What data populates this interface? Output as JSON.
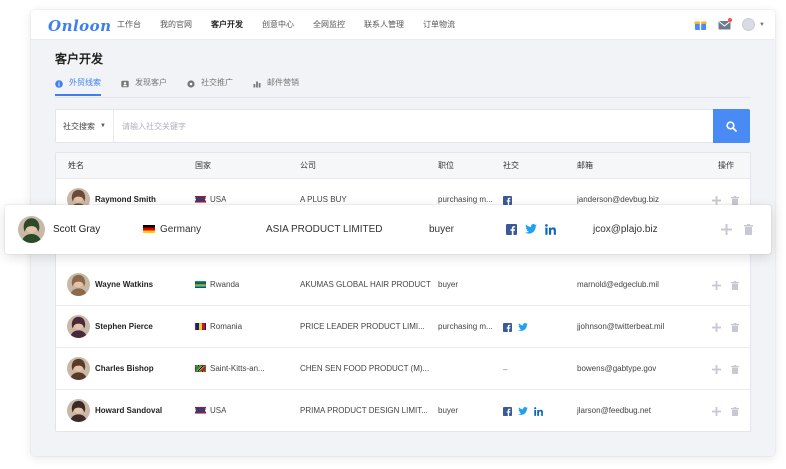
{
  "app": {
    "logo": "Onloon",
    "nav": [
      "工作台",
      "我的官网",
      "客户开发",
      "创意中心",
      "全网监控",
      "联系人管理",
      "订单物流"
    ],
    "nav_active_index": 2
  },
  "page": {
    "title": "客户开发",
    "tabs": [
      {
        "label": "外贸线索",
        "icon": "info-circle-icon",
        "active": true
      },
      {
        "label": "发现客户",
        "icon": "contact-card-icon",
        "active": false
      },
      {
        "label": "社交推广",
        "icon": "gear-icon",
        "active": false
      },
      {
        "label": "邮件营销",
        "icon": "bar-chart-icon",
        "active": false
      }
    ]
  },
  "search": {
    "scope": "社交搜索",
    "placeholder": "请输入社交关键字",
    "value": ""
  },
  "table": {
    "headers": {
      "name": "姓名",
      "country": "国家",
      "company": "公司",
      "position": "职位",
      "social": "社交",
      "email": "邮箱",
      "actions": "操作"
    },
    "rows": [
      {
        "name": "Raymond Smith",
        "country": "USA",
        "flag": "usa",
        "company": "A PLUS BUY",
        "position": "purchasing m...",
        "social": [
          "facebook"
        ],
        "email": "janderson@devbug.biz",
        "avatar": "#6b4a3a"
      },
      {
        "name": "Wayne Watkins",
        "country": "Rwanda",
        "flag": "rwanda",
        "company": "AKUMAS GLOBAL HAIR PRODUCT",
        "position": "buyer",
        "social": [],
        "email": "marnold@edgeclub.mil",
        "avatar": "#8a6a4a"
      },
      {
        "name": "Stephen Pierce",
        "country": "Romania",
        "flag": "romania",
        "company": "PRICE LEADER PRODUCT LIMI...",
        "position": "purchasing m...",
        "social": [
          "facebook",
          "twitter"
        ],
        "email": "jjohnson@twitterbeat.mil",
        "avatar": "#4a2a3a"
      },
      {
        "name": "Charles Bishop",
        "country": "Saint-Kitts-an...",
        "flag": "kitts",
        "company": "CHEN SEN FOOD PRODUCT (M)...",
        "position": "",
        "social_text": "–",
        "social": [],
        "email": "bowens@gabtype.gov",
        "avatar": "#5a3a2a"
      },
      {
        "name": "Howard Sandoval",
        "country": "USA",
        "flag": "usa",
        "company": "PRIMA PRODUCT DESIGN LIMIT...",
        "position": "buyer",
        "social": [
          "facebook",
          "twitter",
          "linkedin"
        ],
        "email": "jlarson@feedbug.net",
        "avatar": "#3a2a2a"
      }
    ],
    "highlight": {
      "name": "Scott Gray",
      "country": "Germany",
      "flag": "germany",
      "company": "ASIA PRODUCT LIMITED",
      "position": "buyer",
      "social": [
        "facebook",
        "twitter",
        "linkedin"
      ],
      "email": "jcox@plajo.biz",
      "avatar": "#2a4a2a"
    }
  },
  "colors": {
    "accent": "#4a8af4",
    "facebook": "#3b5998",
    "twitter": "#1da1f2",
    "linkedin": "#0a66c2"
  }
}
